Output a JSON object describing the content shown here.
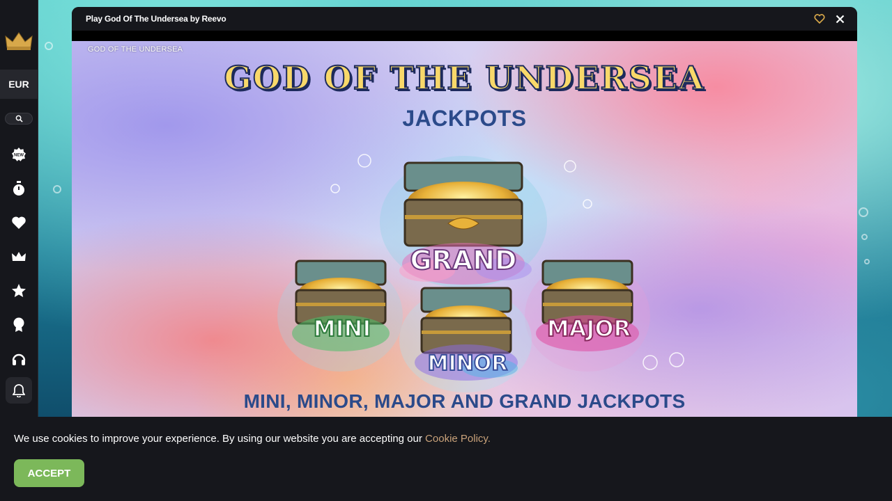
{
  "sidebar": {
    "currency": "EUR",
    "nav_icons": [
      "new-badge-icon",
      "stopwatch-icon",
      "heart-icon",
      "crown-icon",
      "star-icon",
      "trophy-icon",
      "headset-icon"
    ],
    "bell_icon": "bell-icon"
  },
  "modal": {
    "title": "Play God Of The Undersea by Reevo"
  },
  "game": {
    "label": "GOD OF THE UNDERSEA",
    "title": "GOD OF THE UNDERSEA",
    "jackpots_heading": "JACKPOTS",
    "tiers": {
      "grand": "GRAND",
      "mini": "MINI",
      "minor": "MINOR",
      "major": "MAJOR"
    },
    "footer_line": "MINI, MINOR, MAJOR AND GRAND JACKPOTS"
  },
  "cookie": {
    "text": "We use cookies to improve your experience. By using our website you are accepting our ",
    "link": "Cookie Policy.",
    "accept_label": "ACCEPT"
  },
  "colors": {
    "sidebar_bg": "#16171c",
    "accent_gold": "#d8a84a",
    "accept_green": "#7cb85a",
    "link": "#c9a27a",
    "heading_blue": "#2b4a8a"
  }
}
